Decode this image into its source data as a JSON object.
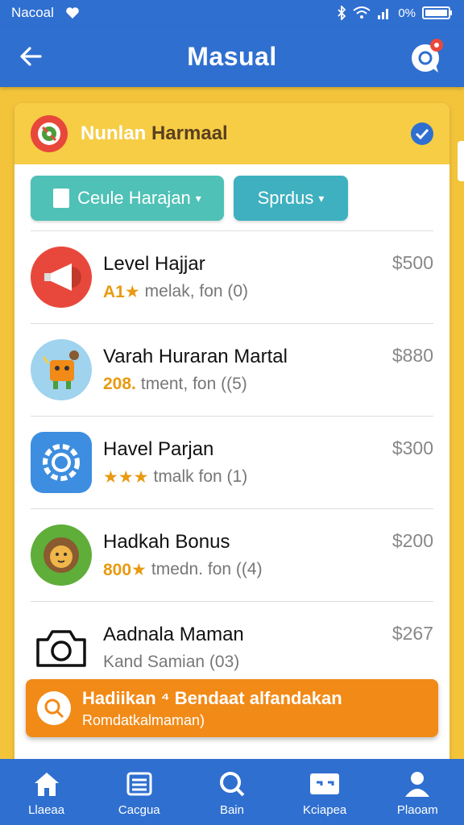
{
  "status_bar": {
    "carrier": "Nacoal",
    "battery_text": "0%",
    "icons": [
      "heart-icon",
      "bluetooth-icon",
      "wifi-icon",
      "signal-icon",
      "battery-icon"
    ]
  },
  "app_bar": {
    "title": "Masual",
    "back_icon": "arrow-left-icon",
    "chat_icon": "chat-icon"
  },
  "card": {
    "header_title_part1": "Nunlan",
    "header_title_part2": "Harmaal",
    "header_logo_icon": "target-icon",
    "header_check_icon": "verified-icon"
  },
  "filters": [
    {
      "label": "Ceule Harajan",
      "icon": "document-icon"
    },
    {
      "label": "Sprdus",
      "icon": "chevron-down-icon"
    }
  ],
  "items": [
    {
      "title": "Level Hajjar",
      "rating": "A1★",
      "subtitle": "melak, fon (0)",
      "price": "$500",
      "icon": "megaphone-icon"
    },
    {
      "title": "Varah Huraran Martal",
      "rating": "208.",
      "subtitle": "tment, fon ((5)",
      "price": "$880",
      "icon": "mascot-icon"
    },
    {
      "title": "Havel Parjan",
      "rating": "★★★",
      "subtitle": "tmalk fon (1)",
      "price": "$300",
      "icon": "gear-icon"
    },
    {
      "title": "Hadkah Bonus",
      "rating": "800★",
      "subtitle": "tmedn. fon ((4)",
      "price": "$200",
      "icon": "lion-icon"
    },
    {
      "title": "Aadnala Maman",
      "rating": "",
      "subtitle": "Kand Samian (03)",
      "price": "$267",
      "icon": "camera-icon"
    }
  ],
  "promo": {
    "title": "Hadiikan ⁴ Bendaat alfandakan",
    "subtitle": "Romdatkalmaman)",
    "icon": "search-icon"
  },
  "bottom_nav": [
    {
      "label": "Llaeaa",
      "icon": "home-icon"
    },
    {
      "label": "Cacgua",
      "icon": "list-icon"
    },
    {
      "label": "Bain",
      "icon": "search-icon"
    },
    {
      "label": "Kciapea",
      "icon": "card-icon"
    },
    {
      "label": "Plaoam",
      "icon": "profile-icon"
    }
  ],
  "colors": {
    "primary": "#2f6fd0",
    "background": "#f3c33a",
    "header": "#f6cd45",
    "promo": "#f28a17",
    "teal": "#4fc1b6"
  }
}
